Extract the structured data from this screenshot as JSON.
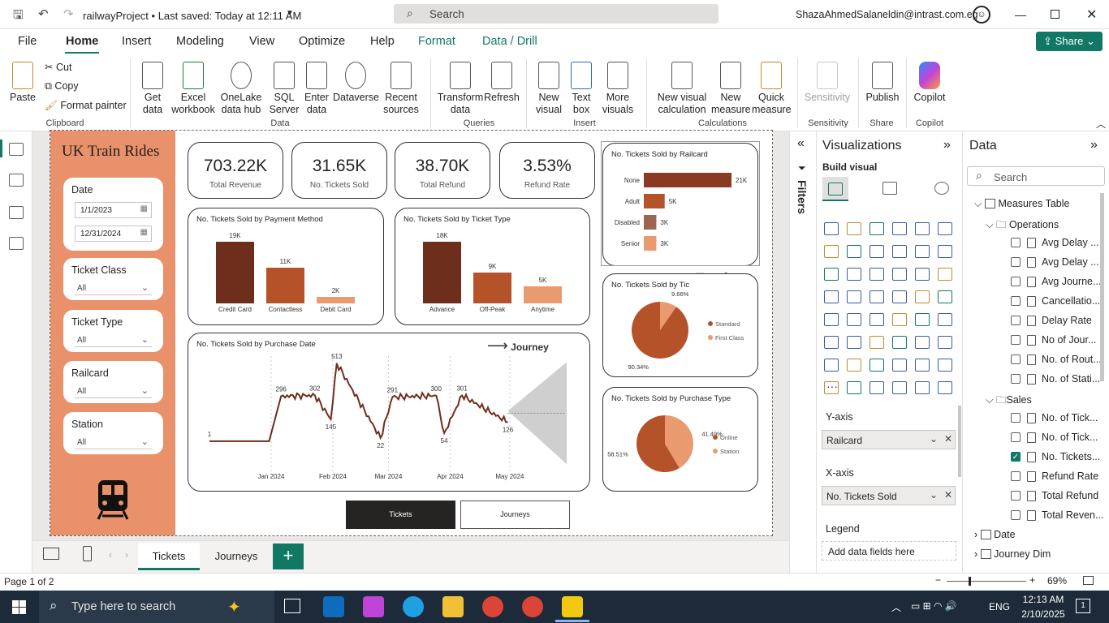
{
  "titlebar": {
    "doc_title": "railwayProject • Last saved: Today at 12:11 AM",
    "search": "Search",
    "user": "ShazaAhmedSalaneldin@intrast.com.eg"
  },
  "menu": {
    "items": [
      "File",
      "Home",
      "Insert",
      "Modeling",
      "View",
      "Optimize",
      "Help",
      "Format",
      "Data / Drill"
    ],
    "share": "Share"
  },
  "ribbon": {
    "clipboard": {
      "paste": "Paste",
      "cut": "Cut",
      "copy": "Copy",
      "format_painter": "Format painter",
      "group": "Clipboard"
    },
    "data": {
      "get_data": "Get data",
      "excel": "Excel workbook",
      "onelake": "OneLake data hub",
      "sql": "SQL Server",
      "enter": "Enter data",
      "dataverse": "Dataverse",
      "recent": "Recent sources",
      "group": "Data"
    },
    "queries": {
      "transform": "Transform data",
      "refresh": "Refresh",
      "group": "Queries"
    },
    "insert": {
      "new_visual": "New visual",
      "text_box": "Text box",
      "more_visuals": "More visuals",
      "group": "Insert"
    },
    "calculations": {
      "new_visual_calc": "New visual calculation",
      "new_measure": "New measure",
      "quick_measure": "Quick measure",
      "group": "Calculations"
    },
    "sensitivity": {
      "label": "Sensitivity",
      "group": "Sensitivity"
    },
    "share": {
      "publish": "Publish",
      "group": "Share"
    },
    "copilot": {
      "label": "Copilot",
      "group": "Copilot"
    }
  },
  "report": {
    "title": "UK Train Rides",
    "slicers": {
      "date": {
        "title": "Date",
        "from": "1/1/2023",
        "to": "12/31/2024"
      },
      "ticket_class": {
        "title": "Ticket Class",
        "value": "All"
      },
      "ticket_type": {
        "title": "Ticket Type",
        "value": "All"
      },
      "railcard": {
        "title": "Railcard",
        "value": "All"
      },
      "station": {
        "title": "Station",
        "value": "All"
      }
    },
    "kpis": [
      {
        "value": "703.22K",
        "label": "Total Revenue"
      },
      {
        "value": "31.65K",
        "label": "No. Tickets Sold"
      },
      {
        "value": "38.70K",
        "label": "Total Refund"
      },
      {
        "value": "3.53%",
        "label": "Refund Rate"
      }
    ],
    "journey_link": "Journey",
    "buttons": {
      "tickets": "Tickets",
      "journeys": "Journeys"
    }
  },
  "chart_data": [
    {
      "type": "bar",
      "title": "No. Tickets Sold by Payment Method",
      "categories": [
        "Credit Card",
        "Contactless",
        "Debit Card"
      ],
      "values": [
        19000,
        11000,
        2000
      ],
      "data_labels": [
        "19K",
        "11K",
        "2K"
      ],
      "colors": [
        "#6e2e1c",
        "#b4532a",
        "#ea9a6f"
      ]
    },
    {
      "type": "bar",
      "title": "No. Tickets Sold by Ticket Type",
      "categories": [
        "Advance",
        "Off-Peak",
        "Anytime"
      ],
      "values": [
        18000,
        9000,
        5000
      ],
      "data_labels": [
        "18K",
        "9K",
        "5K"
      ],
      "colors": [
        "#6e2e1c",
        "#b4532a",
        "#ea9a6f"
      ]
    },
    {
      "type": "bar",
      "orientation": "horizontal",
      "title": "No. Tickets Sold by Railcard",
      "categories": [
        "None",
        "Adult",
        "Disabled",
        "Senior"
      ],
      "values": [
        21000,
        5000,
        3000,
        3000
      ],
      "data_labels": [
        "21K",
        "5K",
        "3K",
        "3K"
      ],
      "colors": [
        "#8a3a22",
        "#b4532a",
        "#9c6650",
        "#ea9a6f"
      ]
    },
    {
      "type": "pie",
      "title": "No. Tickets Sold by Tic",
      "series": [
        {
          "name": "Standard",
          "value": 90.34
        },
        {
          "name": "First Class",
          "value": 9.66
        }
      ],
      "data_labels": [
        "90.34%",
        "9.66%"
      ],
      "colors": [
        "#b4532a",
        "#ea9a6f"
      ]
    },
    {
      "type": "pie",
      "title": "No. Tickets Sold by Purchase Type",
      "series": [
        {
          "name": "Online",
          "value": 58.51
        },
        {
          "name": "Station",
          "value": 41.49
        }
      ],
      "data_labels": [
        "58.51%",
        "41.49%"
      ],
      "colors": [
        "#b4532a",
        "#ea9a6f"
      ]
    },
    {
      "type": "line",
      "title": "No. Tickets Sold by Purchase Date",
      "x_ticks": [
        "Jan 2024",
        "Feb 2024",
        "Mar 2024",
        "Apr 2024",
        "May 2024"
      ],
      "x_tick_pos": [
        31,
        62,
        90,
        121,
        151
      ],
      "labels": [
        {
          "day": 0,
          "value": 1,
          "text": "1"
        },
        {
          "day": 36,
          "value": 296,
          "text": "296"
        },
        {
          "day": 53,
          "value": 302,
          "text": "302"
        },
        {
          "day": 61,
          "value": 145,
          "text": "145"
        },
        {
          "day": 64,
          "value": 513,
          "text": "513"
        },
        {
          "day": 86,
          "value": 22,
          "text": "22"
        },
        {
          "day": 92,
          "value": 291,
          "text": "291"
        },
        {
          "day": 114,
          "value": 300,
          "text": "300"
        },
        {
          "day": 118,
          "value": 54,
          "text": "54"
        },
        {
          "day": 127,
          "value": 301,
          "text": "301"
        },
        {
          "day": 150,
          "value": 126,
          "text": "126"
        }
      ],
      "ylim": [
        0,
        560
      ],
      "x_max": 180,
      "forecast": true,
      "color": "#6e2e1c"
    }
  ],
  "panes": {
    "filters": "Filters",
    "visualizations": {
      "title": "Visualizations",
      "build": "Build visual",
      "y_axis": "Y-axis",
      "y_field": "Railcard",
      "x_axis": "X-axis",
      "x_field": "No. Tickets Sold",
      "legend": "Legend",
      "legend_add": "Add data fields here"
    },
    "data": {
      "title": "Data",
      "search": "Search",
      "measures_table": "Measures Table",
      "operations": "Operations",
      "op_items": [
        "Avg Delay ...",
        "Avg Delay ...",
        "Avg Journe...",
        "Cancellatio...",
        "Delay Rate",
        "No of Jour...",
        "No. of Rout...",
        "No. of Stati..."
      ],
      "sales": "Sales",
      "sales_items": [
        "No. of Tick...",
        "No. of Tick...",
        "No. Tickets...",
        "Refund Rate",
        "Total Refund",
        "Total Reven..."
      ],
      "sales_checked": [
        false,
        false,
        true,
        false,
        false,
        false
      ],
      "date": "Date",
      "journey_dim": "Journey Dim"
    }
  },
  "pages": {
    "tabs": [
      "Tickets",
      "Journeys"
    ],
    "status": "Page 1 of 2",
    "zoom": "69%"
  },
  "taskbar": {
    "search": "Type here to search",
    "time": "12:13 AM",
    "date": "2/10/2025",
    "lang": "ENG"
  }
}
